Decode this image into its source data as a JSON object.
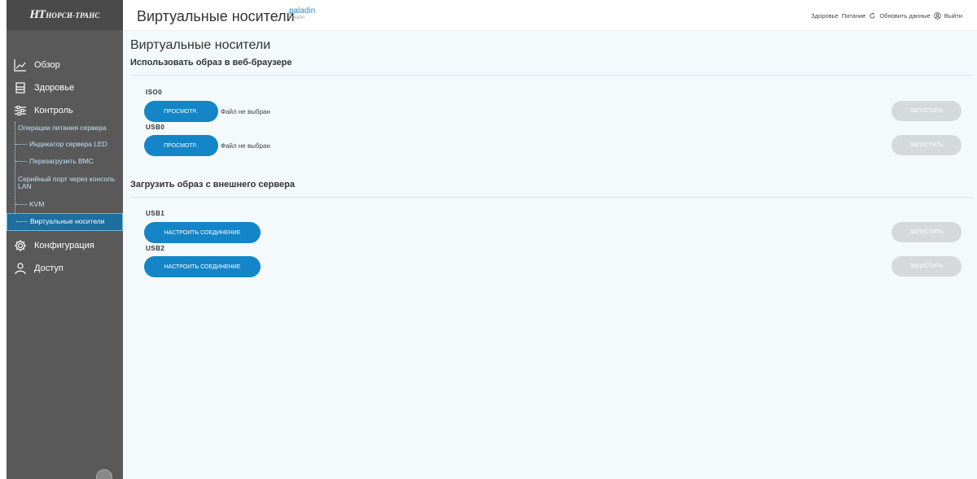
{
  "brand": {
    "mark": "НТ",
    "text": "НОРСИ-ТРАНС"
  },
  "header": {
    "title": "Виртуальные носители",
    "user": "paladin",
    "user_sub": "paladin",
    "links": {
      "health": "Здоровье",
      "power": "Питание",
      "refresh": "Обновить данные",
      "logout": "Выйти"
    }
  },
  "sidebar": {
    "items": [
      {
        "label": "Обзор",
        "icon": "chart-line-icon"
      },
      {
        "label": "Здоровье",
        "icon": "clipboard-icon"
      },
      {
        "label": "Контроль",
        "icon": "sliders-icon"
      },
      {
        "label": "Конфигурация",
        "icon": "gear-icon"
      },
      {
        "label": "Доступ",
        "icon": "user-icon"
      }
    ],
    "control_sub": [
      "Операции питания сервера",
      "Индикатор сервера LED",
      "Перезагрузить BMC",
      "Серийный порт через консоль LAN",
      "KVM",
      "Виртуальные носители"
    ]
  },
  "main": {
    "title": "Виртуальные носители",
    "section_browser": "Использовать образ в веб-браузере",
    "section_server": "Загрузить образ с внешнего сервера",
    "devices_browser": [
      {
        "name": "ISO0",
        "browse": "ПРОСМОТР..",
        "file_status": "Файл не выбран",
        "start": "ЗАПУСТИТЬ"
      },
      {
        "name": "USB0",
        "browse": "ПРОСМОТР..",
        "file_status": "Файл не выбран",
        "start": "ЗАПУСТИТЬ"
      }
    ],
    "devices_server": [
      {
        "name": "USB1",
        "configure": "НАСТРОИТЬ СОЕДИНЕНИЕ",
        "start": "ЗАПУСТИТЬ"
      },
      {
        "name": "USB2",
        "configure": "НАСТРОИТЬ СОЕДИНЕНИЕ",
        "start": "ЗАПУСТИТЬ"
      }
    ]
  },
  "colors": {
    "accent": "#1485c7",
    "sidebar": "#595959",
    "disabled": "#d6d9dc",
    "active_nav": "#1e6e9e"
  }
}
